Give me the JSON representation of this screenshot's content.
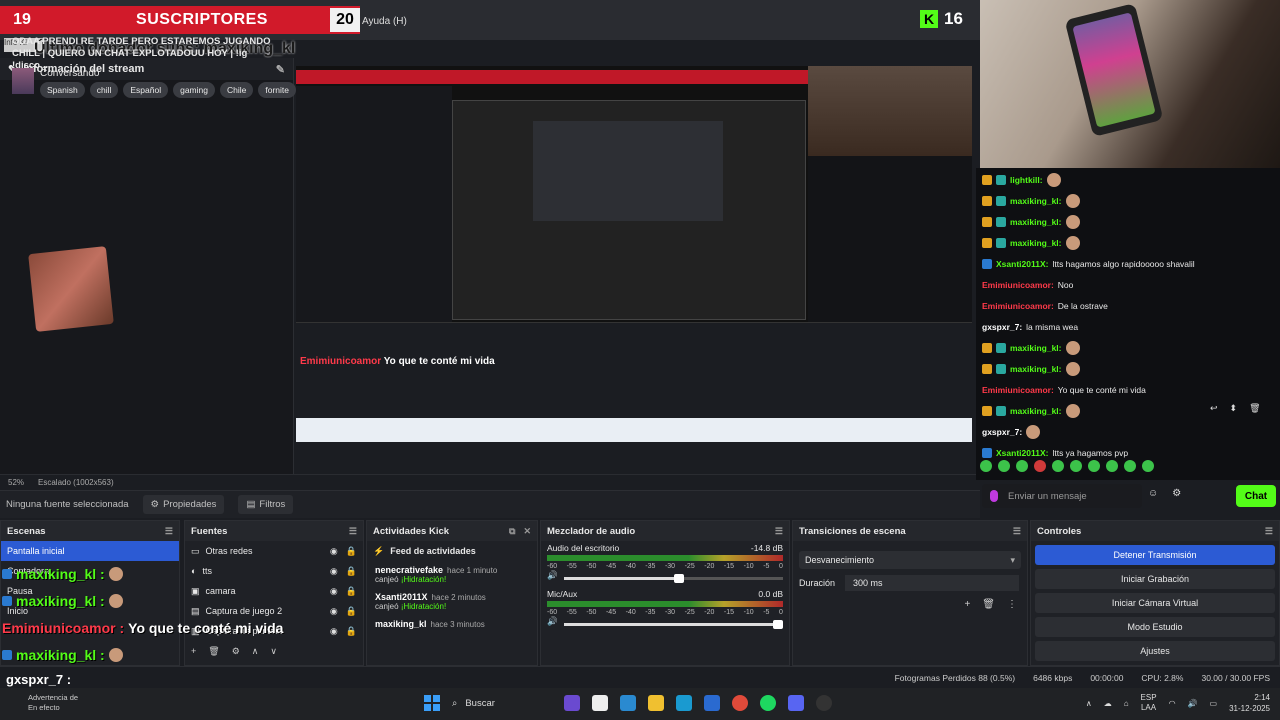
{
  "overlay": {
    "sub_left_count": "19",
    "sub_title": "SUSCRIPTORES",
    "sub_right_count": "20",
    "menu_help": "Ayuda (H)",
    "kick_count": "16",
    "ticker_text": "Último donador subs: maxiking_kl",
    "info_tag": "Info K!"
  },
  "stream_info": {
    "header": "Información del stream",
    "title": "ODAA PRENDI RE TARDE PERO ESTAREMOS JUGANDO CHILL | QUIERO UN CHAT EXPLOTADOUU HOY | !ig !disco...",
    "category": "Conversando",
    "tags": [
      "Spanish",
      "chill",
      "Español",
      "gaming",
      "Chile",
      "fornite"
    ]
  },
  "preview_overlay": {
    "msg_user": "Emimiunicoamor",
    "msg_text": "Yo que te conté mi vida"
  },
  "preview_status": {
    "zoom": "52%",
    "scale": "Escalado (1002x563)"
  },
  "source_bar": {
    "no_source": "Ninguna fuente seleccionada",
    "properties": "Propiedades",
    "filters": "Filtros"
  },
  "chat": {
    "messages": [
      {
        "user": "lightkill:",
        "color": "green",
        "text": ""
      },
      {
        "user": "maxiking_kl:",
        "color": "green",
        "text": ""
      },
      {
        "user": "maxiking_kl:",
        "color": "green",
        "text": ""
      },
      {
        "user": "maxiking_kl:",
        "color": "green",
        "text": ""
      },
      {
        "user": "Xsanti2011X:",
        "color": "green",
        "text": "ltts hagamos algo rapidooooo shavalil"
      },
      {
        "user": "Emimiunicoamor:",
        "color": "red",
        "text": "Noo"
      },
      {
        "user": "Emimiunicoamor:",
        "color": "red",
        "text": "De la ostrave"
      },
      {
        "user": "gxspxr_7:",
        "color": "white",
        "text": "la misma wea"
      },
      {
        "user": "maxiking_kl:",
        "color": "green",
        "text": ""
      },
      {
        "user": "maxiking_kl:",
        "color": "green",
        "text": ""
      },
      {
        "user": "Emimiunicoamor:",
        "color": "red",
        "text": "Yo que te conté mi vida"
      },
      {
        "user": "maxiking_kl:",
        "color": "green",
        "text": ""
      },
      {
        "user": "gxspxr_7:",
        "color": "white",
        "text": ""
      },
      {
        "user": "Xsanti2011X:",
        "color": "green",
        "text": "ltts ya hagamos pvp"
      }
    ],
    "input_placeholder": "Enviar un mensaje",
    "send_label": "Chat"
  },
  "docks": {
    "scenes": {
      "title": "Escenas",
      "items": [
        "Pantalla inicial",
        "Contadora",
        "Pausa",
        "Inicio"
      ]
    },
    "sources": {
      "title": "Fuentes",
      "items": [
        "Otras redes",
        "tts",
        "camara",
        "Captura de juego 2",
        "Captura de pantalla"
      ]
    },
    "activity": {
      "title": "Actividades Kick",
      "feed_title": "Feed de actividades",
      "items": [
        {
          "user": "nenecrativefake",
          "time": "hace 1 minuto",
          "action": "canjeó",
          "reward": "¡Hidratación!"
        },
        {
          "user": "Xsanti2011X",
          "time": "hace 2 minutos",
          "action": "canjeó",
          "reward": "¡Hidratación!"
        },
        {
          "user": "maxiking_kl",
          "time": "hace 3 minutos",
          "action": "",
          "reward": ""
        }
      ]
    },
    "mixer": {
      "title": "Mezclador de audio",
      "channels": [
        {
          "name": "Audio del escritorio",
          "db": "-14.8 dB",
          "volume_fraction": 0.55
        },
        {
          "name": "Mic/Aux",
          "db": "0.0 dB",
          "volume_fraction": 1.0
        }
      ],
      "scale": [
        "-60",
        "-55",
        "-50",
        "-45",
        "-40",
        "-35",
        "-30",
        "-25",
        "-20",
        "-15",
        "-10",
        "-5",
        "0"
      ]
    },
    "transitions": {
      "title": "Transiciones de escena",
      "selected": "Desvanecimiento",
      "duration_label": "Duración",
      "duration_value": "300 ms"
    },
    "controls": {
      "title": "Controles",
      "buttons": [
        "Detener Transmisión",
        "Iniciar Grabación",
        "Iniciar Cámara Virtual",
        "Modo Estudio",
        "Ajustes"
      ]
    }
  },
  "scene_overlay_chat": [
    {
      "user": "maxiking_kl :",
      "color": "green",
      "text": ""
    },
    {
      "user": "maxiking_kl :",
      "color": "green",
      "text": ""
    },
    {
      "user": "Emimiunicoamor :",
      "color": "red",
      "text": "Yo que te conté mi vida"
    },
    {
      "user": "maxiking_kl :",
      "color": "green",
      "text": ""
    }
  ],
  "bottom_user": "gxspxr_7 :",
  "status": {
    "dropped": "Fotogramas Perdidos 88 (0.5%)",
    "kbps": "6486 kbps",
    "time": "00:00:00",
    "cpu": "CPU: 2.8%",
    "fps": "30.00 / 30.00 FPS"
  },
  "taskbar": {
    "warning_title": "Advertencia de",
    "warning_sub": "En efecto",
    "search": "Buscar",
    "lang": "ESP",
    "lang_sub": "LAA",
    "time": "2:14",
    "date": "31-12-2025"
  },
  "colors": {
    "accent": "#2c5bd4",
    "kick_green": "#53fc18",
    "banner_red": "#d11a2a"
  }
}
